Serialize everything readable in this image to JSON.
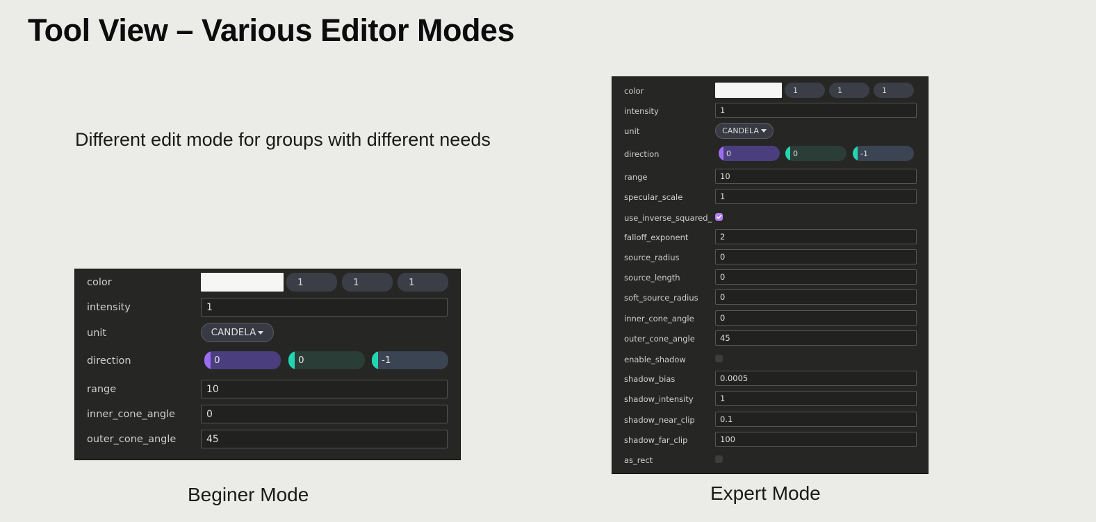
{
  "slide": {
    "title": "Tool View – Various Editor Modes",
    "subtitle": "Different edit mode for groups with different needs",
    "beginner_caption": "Beginer Mode",
    "expert_caption": "Expert Mode"
  },
  "colors": {
    "vector_x_handle": "#9b6df0",
    "vector_yz_handle": "#22d6b1",
    "checkbox_checked": "#b27ef2",
    "panel_background": "#262624"
  },
  "beginner": {
    "color": {
      "label": "color",
      "r": "1",
      "g": "1",
      "b": "1"
    },
    "intensity": {
      "label": "intensity",
      "value": "1"
    },
    "unit": {
      "label": "unit",
      "value": "CANDELA"
    },
    "direction": {
      "label": "direction",
      "x": "0",
      "y": "0",
      "z": "-1"
    },
    "range": {
      "label": "range",
      "value": "10"
    },
    "inner_cone_angle": {
      "label": "inner_cone_angle",
      "value": "0"
    },
    "outer_cone_angle": {
      "label": "outer_cone_angle",
      "value": "45"
    }
  },
  "expert": {
    "color": {
      "label": "color",
      "r": "1",
      "g": "1",
      "b": "1"
    },
    "intensity": {
      "label": "intensity",
      "value": "1"
    },
    "unit": {
      "label": "unit",
      "value": "CANDELA"
    },
    "direction": {
      "label": "direction",
      "x": "0",
      "y": "0",
      "z": "-1"
    },
    "range": {
      "label": "range",
      "value": "10"
    },
    "specular_scale": {
      "label": "specular_scale",
      "value": "1"
    },
    "use_inverse_squared": {
      "label": "use_inverse_squared_",
      "checked": true
    },
    "falloff_exponent": {
      "label": "falloff_exponent",
      "value": "2"
    },
    "source_radius": {
      "label": "source_radius",
      "value": "0"
    },
    "source_length": {
      "label": "source_length",
      "value": "0"
    },
    "soft_source_radius": {
      "label": "soft_source_radius",
      "value": "0"
    },
    "inner_cone_angle": {
      "label": "inner_cone_angle",
      "value": "0"
    },
    "outer_cone_angle": {
      "label": "outer_cone_angle",
      "value": "45"
    },
    "enable_shadow": {
      "label": "enable_shadow",
      "checked": false
    },
    "shadow_bias": {
      "label": "shadow_bias",
      "value": "0.0005"
    },
    "shadow_intensity": {
      "label": "shadow_intensity",
      "value": "1"
    },
    "shadow_near_clip": {
      "label": "shadow_near_clip",
      "value": "0.1"
    },
    "shadow_far_clip": {
      "label": "shadow_far_clip",
      "value": "100"
    },
    "as_rect": {
      "label": "as_rect",
      "checked": false
    }
  }
}
